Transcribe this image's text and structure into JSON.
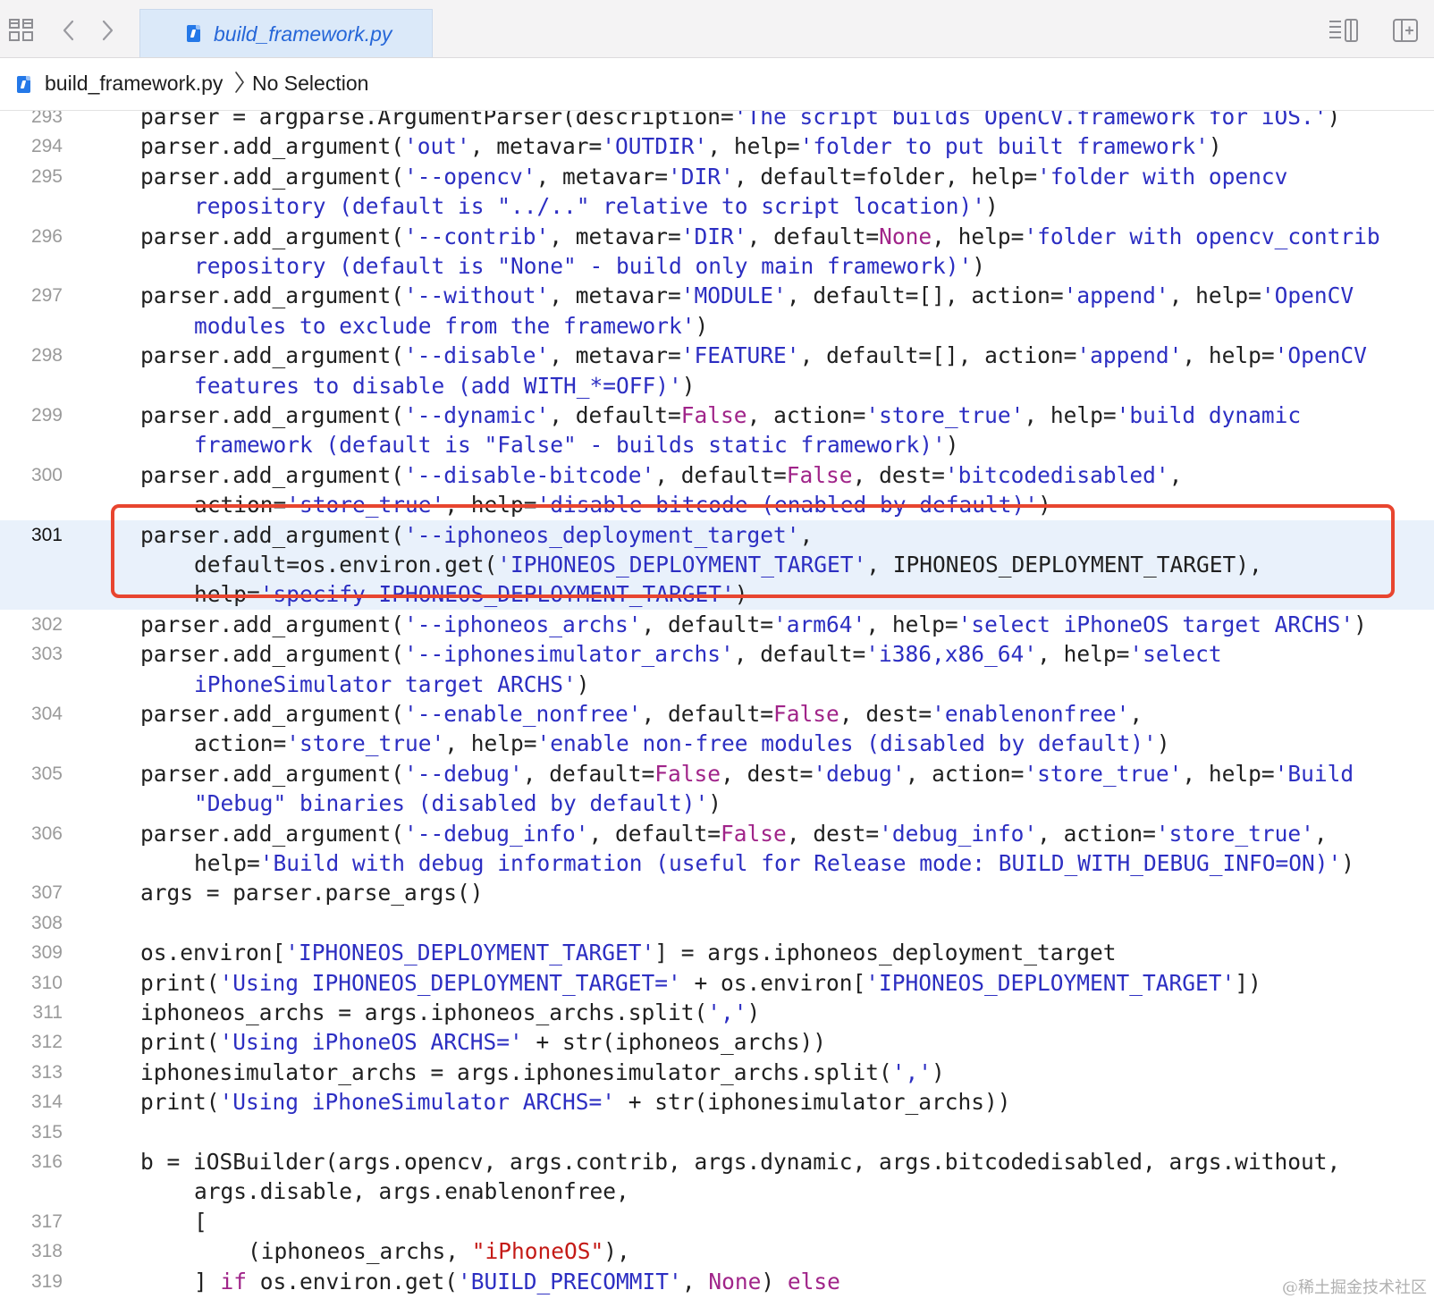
{
  "tab_bar": {
    "active_tab": "build_framework.py",
    "icons": [
      "grid-icon",
      "chevron-left-icon",
      "chevron-right-icon",
      "inspector-icon",
      "add-editor-icon"
    ]
  },
  "jump_bar": {
    "file": "build_framework.py",
    "selection": "No Selection"
  },
  "highlight_color": "#e9f1fb",
  "annotation_color": "#e8452f",
  "watermark": "@稀土掘金技术社区",
  "code_lines": [
    {
      "num": "293",
      "segs": [
        [
          "p",
          "parser = argparse.ArgumentParser(description="
        ],
        [
          "s",
          "'The script builds OpenCV.framework for iOS.'"
        ],
        [
          "p",
          ")"
        ]
      ]
    },
    {
      "num": "294",
      "segs": [
        [
          "p",
          "parser.add_argument("
        ],
        [
          "s",
          "'out'"
        ],
        [
          "p",
          ", metavar="
        ],
        [
          "s",
          "'OUTDIR'"
        ],
        [
          "p",
          ", help="
        ],
        [
          "s",
          "'folder to put built framework'"
        ],
        [
          "p",
          ")"
        ]
      ]
    },
    {
      "num": "295",
      "segs": [
        [
          "p",
          "parser.add_argument("
        ],
        [
          "s",
          "'--opencv'"
        ],
        [
          "p",
          ", metavar="
        ],
        [
          "s",
          "'DIR'"
        ],
        [
          "p",
          ", default=folder, help="
        ],
        [
          "s",
          "'folder with opencv"
        ]
      ]
    },
    {
      "num": "",
      "cont": true,
      "segs": [
        [
          "s",
          "repository (default is \"../..\" relative to script location)'"
        ],
        [
          "p",
          ")"
        ]
      ]
    },
    {
      "num": "296",
      "segs": [
        [
          "p",
          "parser.add_argument("
        ],
        [
          "s",
          "'--contrib'"
        ],
        [
          "p",
          ", metavar="
        ],
        [
          "s",
          "'DIR'"
        ],
        [
          "p",
          ", default="
        ],
        [
          "k",
          "None"
        ],
        [
          "p",
          ", help="
        ],
        [
          "s",
          "'folder with opencv_contrib"
        ]
      ]
    },
    {
      "num": "",
      "cont": true,
      "segs": [
        [
          "s",
          "repository (default is \"None\" - build only main framework)'"
        ],
        [
          "p",
          ")"
        ]
      ]
    },
    {
      "num": "297",
      "segs": [
        [
          "p",
          "parser.add_argument("
        ],
        [
          "s",
          "'--without'"
        ],
        [
          "p",
          ", metavar="
        ],
        [
          "s",
          "'MODULE'"
        ],
        [
          "p",
          ", default=[], action="
        ],
        [
          "s",
          "'append'"
        ],
        [
          "p",
          ", help="
        ],
        [
          "s",
          "'OpenCV"
        ]
      ]
    },
    {
      "num": "",
      "cont": true,
      "segs": [
        [
          "s",
          "modules to exclude from the framework'"
        ],
        [
          "p",
          ")"
        ]
      ]
    },
    {
      "num": "298",
      "segs": [
        [
          "p",
          "parser.add_argument("
        ],
        [
          "s",
          "'--disable'"
        ],
        [
          "p",
          ", metavar="
        ],
        [
          "s",
          "'FEATURE'"
        ],
        [
          "p",
          ", default=[], action="
        ],
        [
          "s",
          "'append'"
        ],
        [
          "p",
          ", help="
        ],
        [
          "s",
          "'OpenCV"
        ]
      ]
    },
    {
      "num": "",
      "cont": true,
      "segs": [
        [
          "s",
          "features to disable (add WITH_*=OFF)'"
        ],
        [
          "p",
          ")"
        ]
      ]
    },
    {
      "num": "299",
      "segs": [
        [
          "p",
          "parser.add_argument("
        ],
        [
          "s",
          "'--dynamic'"
        ],
        [
          "p",
          ", default="
        ],
        [
          "k",
          "False"
        ],
        [
          "p",
          ", action="
        ],
        [
          "s",
          "'store_true'"
        ],
        [
          "p",
          ", help="
        ],
        [
          "s",
          "'build dynamic"
        ]
      ]
    },
    {
      "num": "",
      "cont": true,
      "segs": [
        [
          "s",
          "framework (default is \"False\" - builds static framework)'"
        ],
        [
          "p",
          ")"
        ]
      ]
    },
    {
      "num": "300",
      "segs": [
        [
          "p",
          "parser.add_argument("
        ],
        [
          "s",
          "'--disable-bitcode'"
        ],
        [
          "p",
          ", default="
        ],
        [
          "k",
          "False"
        ],
        [
          "p",
          ", dest="
        ],
        [
          "s",
          "'bitcodedisabled'"
        ],
        [
          "p",
          ","
        ]
      ]
    },
    {
      "num": "",
      "cont": true,
      "segs": [
        [
          "p",
          "action="
        ],
        [
          "s",
          "'store_true'"
        ],
        [
          "p",
          ", help="
        ],
        [
          "s",
          "'disable bitcode (enabled by default)'"
        ],
        [
          "p",
          ")"
        ]
      ]
    },
    {
      "num": "301",
      "current": true,
      "segs": [
        [
          "p",
          "parser.add_argument("
        ],
        [
          "s",
          "'--iphoneos_deployment_target'"
        ],
        [
          "p",
          ","
        ]
      ]
    },
    {
      "num": "",
      "cont": true,
      "segs": [
        [
          "p",
          "default=os.environ.get("
        ],
        [
          "s",
          "'IPHONEOS_DEPLOYMENT_TARGET'"
        ],
        [
          "p",
          ", IPHONEOS_DEPLOYMENT_TARGET),"
        ]
      ]
    },
    {
      "num": "",
      "cont": true,
      "segs": [
        [
          "p",
          "help="
        ],
        [
          "s",
          "'specify IPHONEOS_DEPLOYMENT_TARGET'"
        ],
        [
          "p",
          ")"
        ]
      ]
    },
    {
      "num": "302",
      "segs": [
        [
          "p",
          "parser.add_argument("
        ],
        [
          "s",
          "'--iphoneos_archs'"
        ],
        [
          "p",
          ", default="
        ],
        [
          "s",
          "'arm64'"
        ],
        [
          "p",
          ", help="
        ],
        [
          "s",
          "'select iPhoneOS target ARCHS'"
        ],
        [
          "p",
          ")"
        ]
      ]
    },
    {
      "num": "303",
      "segs": [
        [
          "p",
          "parser.add_argument("
        ],
        [
          "s",
          "'--iphonesimulator_archs'"
        ],
        [
          "p",
          ", default="
        ],
        [
          "s",
          "'i386,x86_64'"
        ],
        [
          "p",
          ", help="
        ],
        [
          "s",
          "'select"
        ]
      ]
    },
    {
      "num": "",
      "cont": true,
      "segs": [
        [
          "s",
          "iPhoneSimulator target ARCHS'"
        ],
        [
          "p",
          ")"
        ]
      ]
    },
    {
      "num": "304",
      "segs": [
        [
          "p",
          "parser.add_argument("
        ],
        [
          "s",
          "'--enable_nonfree'"
        ],
        [
          "p",
          ", default="
        ],
        [
          "k",
          "False"
        ],
        [
          "p",
          ", dest="
        ],
        [
          "s",
          "'enablenonfree'"
        ],
        [
          "p",
          ","
        ]
      ]
    },
    {
      "num": "",
      "cont": true,
      "segs": [
        [
          "p",
          "action="
        ],
        [
          "s",
          "'store_true'"
        ],
        [
          "p",
          ", help="
        ],
        [
          "s",
          "'enable non-free modules (disabled by default)'"
        ],
        [
          "p",
          ")"
        ]
      ]
    },
    {
      "num": "305",
      "segs": [
        [
          "p",
          "parser.add_argument("
        ],
        [
          "s",
          "'--debug'"
        ],
        [
          "p",
          ", default="
        ],
        [
          "k",
          "False"
        ],
        [
          "p",
          ", dest="
        ],
        [
          "s",
          "'debug'"
        ],
        [
          "p",
          ", action="
        ],
        [
          "s",
          "'store_true'"
        ],
        [
          "p",
          ", help="
        ],
        [
          "s",
          "'Build"
        ]
      ]
    },
    {
      "num": "",
      "cont": true,
      "segs": [
        [
          "s",
          "\"Debug\" binaries (disabled by default)'"
        ],
        [
          "p",
          ")"
        ]
      ]
    },
    {
      "num": "306",
      "segs": [
        [
          "p",
          "parser.add_argument("
        ],
        [
          "s",
          "'--debug_info'"
        ],
        [
          "p",
          ", default="
        ],
        [
          "k",
          "False"
        ],
        [
          "p",
          ", dest="
        ],
        [
          "s",
          "'debug_info'"
        ],
        [
          "p",
          ", action="
        ],
        [
          "s",
          "'store_true'"
        ],
        [
          "p",
          ","
        ]
      ]
    },
    {
      "num": "",
      "cont": true,
      "segs": [
        [
          "p",
          "help="
        ],
        [
          "s",
          "'Build with debug information (useful for Release mode: BUILD_WITH_DEBUG_INFO=ON)'"
        ],
        [
          "p",
          ")"
        ]
      ]
    },
    {
      "num": "307",
      "segs": [
        [
          "p",
          "args = parser.parse_args()"
        ]
      ]
    },
    {
      "num": "308",
      "segs": []
    },
    {
      "num": "309",
      "segs": [
        [
          "p",
          "os.environ["
        ],
        [
          "s",
          "'IPHONEOS_DEPLOYMENT_TARGET'"
        ],
        [
          "p",
          "] = args.iphoneos_deployment_target"
        ]
      ]
    },
    {
      "num": "310",
      "segs": [
        [
          "p",
          "print("
        ],
        [
          "s",
          "'Using IPHONEOS_DEPLOYMENT_TARGET='"
        ],
        [
          "p",
          " + os.environ["
        ],
        [
          "s",
          "'IPHONEOS_DEPLOYMENT_TARGET'"
        ],
        [
          "p",
          "])"
        ]
      ]
    },
    {
      "num": "311",
      "segs": [
        [
          "p",
          "iphoneos_archs = args.iphoneos_archs.split("
        ],
        [
          "s",
          "','"
        ],
        [
          "p",
          ")"
        ]
      ]
    },
    {
      "num": "312",
      "segs": [
        [
          "p",
          "print("
        ],
        [
          "s",
          "'Using iPhoneOS ARCHS='"
        ],
        [
          "p",
          " + str(iphoneos_archs))"
        ]
      ]
    },
    {
      "num": "313",
      "segs": [
        [
          "p",
          "iphonesimulator_archs = args.iphonesimulator_archs.split("
        ],
        [
          "s",
          "','"
        ],
        [
          "p",
          ")"
        ]
      ]
    },
    {
      "num": "314",
      "segs": [
        [
          "p",
          "print("
        ],
        [
          "s",
          "'Using iPhoneSimulator ARCHS='"
        ],
        [
          "p",
          " + str(iphonesimulator_archs))"
        ]
      ]
    },
    {
      "num": "315",
      "segs": []
    },
    {
      "num": "316",
      "segs": [
        [
          "p",
          "b = iOSBuilder(args.opencv, args.contrib, args.dynamic, args.bitcodedisabled, args.without,"
        ]
      ]
    },
    {
      "num": "",
      "cont": true,
      "segs": [
        [
          "p",
          "args.disable, args.enablenonfree,"
        ]
      ]
    },
    {
      "num": "317",
      "cont": true,
      "segs": [
        [
          "p",
          "["
        ]
      ]
    },
    {
      "num": "318",
      "cont": true,
      "extra": true,
      "segs": [
        [
          "p",
          "(iphoneos_archs, "
        ],
        [
          "r",
          "\"iPhoneOS\""
        ],
        [
          "p",
          "),"
        ]
      ]
    },
    {
      "num": "319",
      "cont": true,
      "segs": [
        [
          "p",
          "] "
        ],
        [
          "k",
          "if"
        ],
        [
          "p",
          " os.environ.get("
        ],
        [
          "s",
          "'BUILD_PRECOMMIT'"
        ],
        [
          "p",
          ", "
        ],
        [
          "k",
          "None"
        ],
        [
          "p",
          ") "
        ],
        [
          "k",
          "else"
        ]
      ]
    }
  ]
}
